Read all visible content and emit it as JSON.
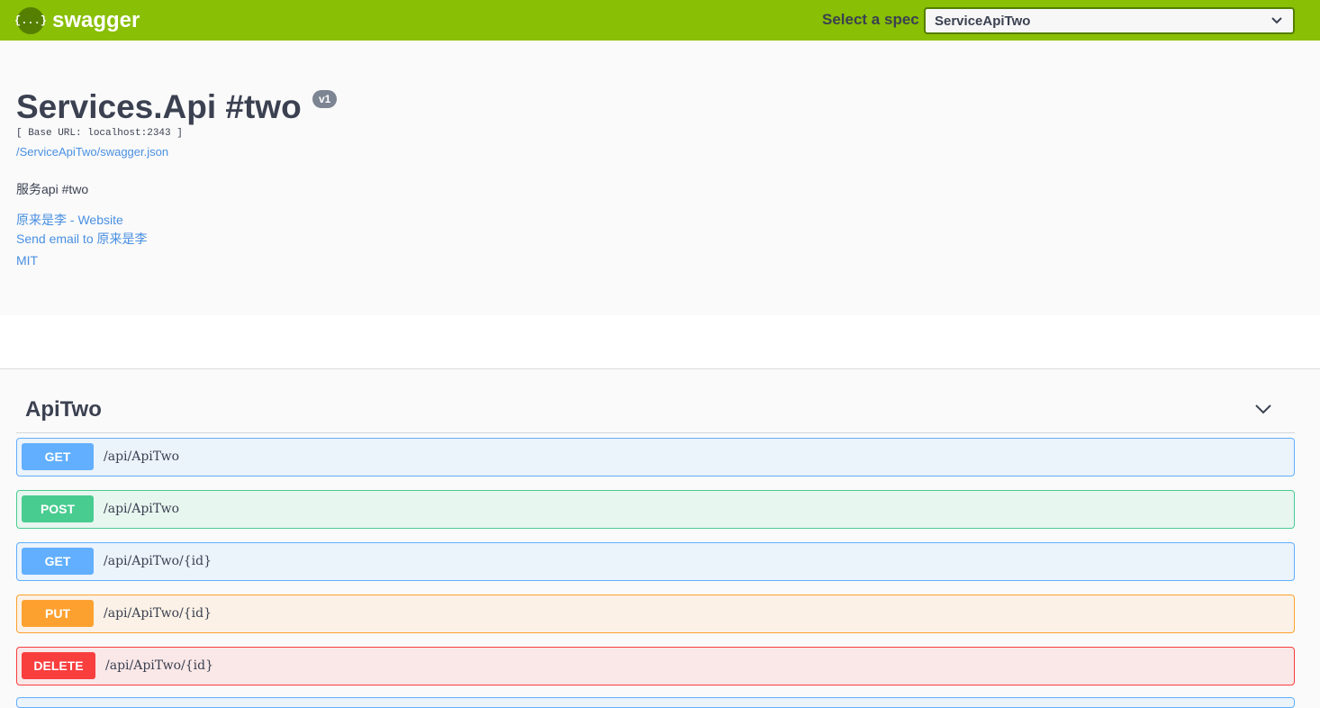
{
  "topbar": {
    "logo_icon_text": "{...}",
    "logo_text": "swagger",
    "spec_label": "Select a spec",
    "spec_value": "ServiceApiTwo",
    "bg_color": "#89bf04"
  },
  "info": {
    "title": "Services.Api #two",
    "version": "v1",
    "base_url": "[ Base URL: localhost:2343 ]",
    "spec_link": "/ServiceApiTwo/swagger.json",
    "description": "服务api #two",
    "website_link": "原来是李 - Website",
    "email_link": "Send email to 原来是李",
    "license_link": "MIT"
  },
  "tag": {
    "name": "ApiTwo"
  },
  "operations": [
    {
      "method": "GET",
      "path": "/api/ApiTwo",
      "color": "#61affe"
    },
    {
      "method": "POST",
      "path": "/api/ApiTwo",
      "color": "#49cc90"
    },
    {
      "method": "GET",
      "path": "/api/ApiTwo/{id}",
      "color": "#61affe"
    },
    {
      "method": "PUT",
      "path": "/api/ApiTwo/{id}",
      "color": "#fca130"
    },
    {
      "method": "DELETE",
      "path": "/api/ApiTwo/{id}",
      "color": "#f93e3e"
    }
  ]
}
